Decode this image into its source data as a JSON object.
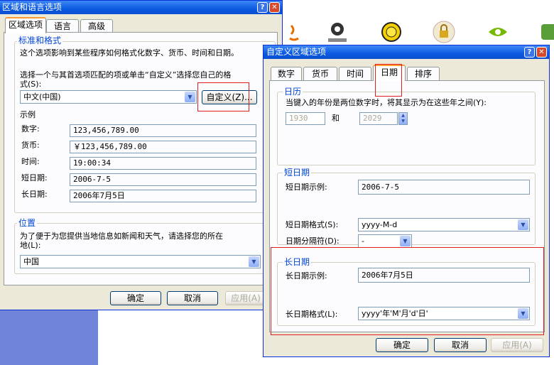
{
  "left_window": {
    "title": "区域和语言选项",
    "tabs": [
      "区域选项",
      "语言",
      "高级"
    ],
    "standards_group": {
      "title": "标准和格式",
      "description": "这个选项影响到某些程序如何格式化数字、货币、时间和日期。",
      "instruction_line1": "选择一个与其首选项匹配的项或单击“自定义”选择您自己的格",
      "instruction_line2": "式(S):",
      "locale_selected": "中文(中国)",
      "customize_button": "自定义(Z)...",
      "samples_title": "示例",
      "samples": [
        {
          "label": "数字:",
          "value": "123,456,789.00"
        },
        {
          "label": "货币:",
          "value": "￥123,456,789.00"
        },
        {
          "label": "时间:",
          "value": "19:00:34"
        },
        {
          "label": "短日期:",
          "value": "2006-7-5"
        },
        {
          "label": "长日期:",
          "value": "2006年7月5日"
        }
      ]
    },
    "location_group": {
      "title": "位置",
      "description_line1": "为了便于为您提供当地信息如新闻和天气，请选择您的所在",
      "description_line2": "地(L):",
      "selected": "中国"
    },
    "buttons": {
      "ok": "确定",
      "cancel": "取消",
      "apply": "应用(A)"
    }
  },
  "right_window": {
    "title": "自定义区域选项",
    "tabs": [
      "数字",
      "货币",
      "时间",
      "日期",
      "排序"
    ],
    "active_tab": "日期",
    "calendar_group": {
      "title": "日历",
      "description": "当键入的年份是两位数字时，将其显示为在这些年之间(Y):",
      "year_from": "1930",
      "and_label": "和",
      "year_to": "2029"
    },
    "short_date_group": {
      "title": "短日期",
      "sample_label": "短日期示例:",
      "sample_value": "2006-7-5",
      "format_label": "短日期格式(S):",
      "format_value": "yyyy-M-d",
      "separator_label": "日期分隔符(D):",
      "separator_value": "-"
    },
    "long_date_group": {
      "title": "长日期",
      "sample_label": "长日期示例:",
      "sample_value": "2006年7月5日",
      "format_label": "长日期格式(L):",
      "format_value": "yyyy'年'M'月'd'日'"
    },
    "buttons": {
      "ok": "确定",
      "cancel": "取消",
      "apply": "应用(A)"
    }
  },
  "colors": {
    "titlebar": "#0b5ae0",
    "group_title": "#0046d5",
    "highlight": "#e02020",
    "background_strip": "#6f84d9"
  }
}
